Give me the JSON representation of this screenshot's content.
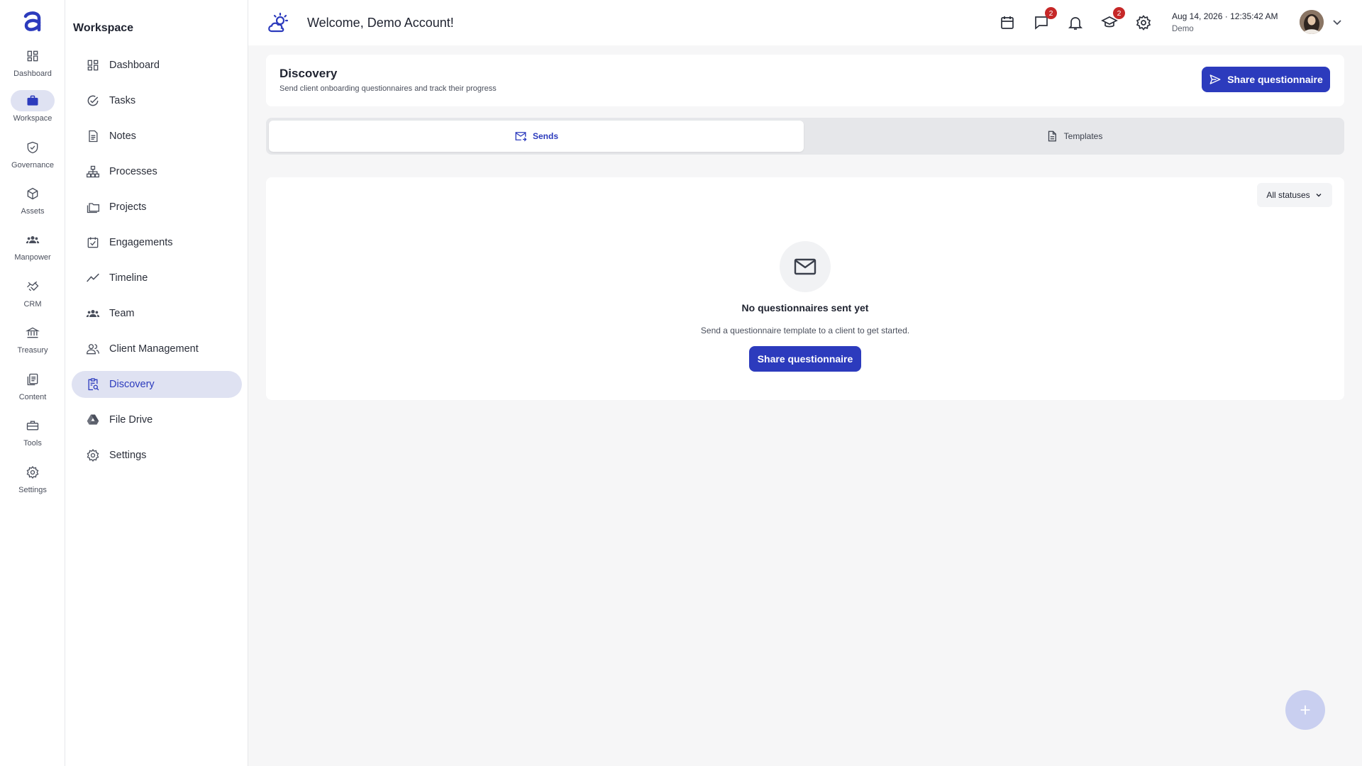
{
  "rail": {
    "logo_icon": "brand-a-icon",
    "items": [
      {
        "label": "Dashboard",
        "icon": "grid-icon"
      },
      {
        "label": "Workspace",
        "icon": "briefcase-icon"
      },
      {
        "label": "Governance",
        "icon": "shield-check-icon"
      },
      {
        "label": "Assets",
        "icon": "cube-icon"
      },
      {
        "label": "Manpower",
        "icon": "people-icon"
      },
      {
        "label": "CRM",
        "icon": "handshake-icon"
      },
      {
        "label": "Treasury",
        "icon": "bank-icon"
      },
      {
        "label": "Content",
        "icon": "documents-icon"
      },
      {
        "label": "Tools",
        "icon": "toolbox-icon"
      },
      {
        "label": "Settings",
        "icon": "gear-icon"
      }
    ]
  },
  "sidenav": {
    "title": "Workspace",
    "items": [
      {
        "label": "Dashboard",
        "icon": "grid-icon"
      },
      {
        "label": "Tasks",
        "icon": "check-circle-icon"
      },
      {
        "label": "Notes",
        "icon": "note-icon"
      },
      {
        "label": "Processes",
        "icon": "hierarchy-icon"
      },
      {
        "label": "Projects",
        "icon": "folders-icon"
      },
      {
        "label": "Engagements",
        "icon": "calendar-check-icon"
      },
      {
        "label": "Timeline",
        "icon": "trend-icon"
      },
      {
        "label": "Team",
        "icon": "people-icon"
      },
      {
        "label": "Client Management",
        "icon": "client-icon"
      },
      {
        "label": "Discovery",
        "icon": "clipboard-search-icon"
      },
      {
        "label": "File Drive",
        "icon": "drive-icon"
      },
      {
        "label": "Settings",
        "icon": "gear-icon"
      }
    ],
    "active_index": 9
  },
  "header": {
    "brand_icon": "sun-cloud-icon",
    "welcome": "Welcome, Demo Account!",
    "chat_badge": "2",
    "learning_badge": "2",
    "date": "Aug 14, 2026",
    "separator": "·",
    "time": "12:35:42 AM",
    "org": "Demo"
  },
  "page": {
    "title": "Discovery",
    "subtitle": "Send client onboarding questionnaires and track their progress",
    "share_label": "Share questionnaire"
  },
  "tabs": [
    {
      "label": "Sends",
      "icon": "mail-send-icon",
      "active": true
    },
    {
      "label": "Templates",
      "icon": "document-icon",
      "active": false
    }
  ],
  "panel": {
    "status_filter": "All statuses",
    "empty_icon": "envelope-icon",
    "empty_title": "No questionnaires sent yet",
    "empty_desc": "Send a questionnaire template to a client to get started.",
    "empty_button": "Share questionnaire"
  },
  "colors": {
    "accent": "#2c3bbd",
    "active_bg": "#dfe2f2",
    "badge": "#c62828",
    "page_bg": "#f6f6f7"
  }
}
